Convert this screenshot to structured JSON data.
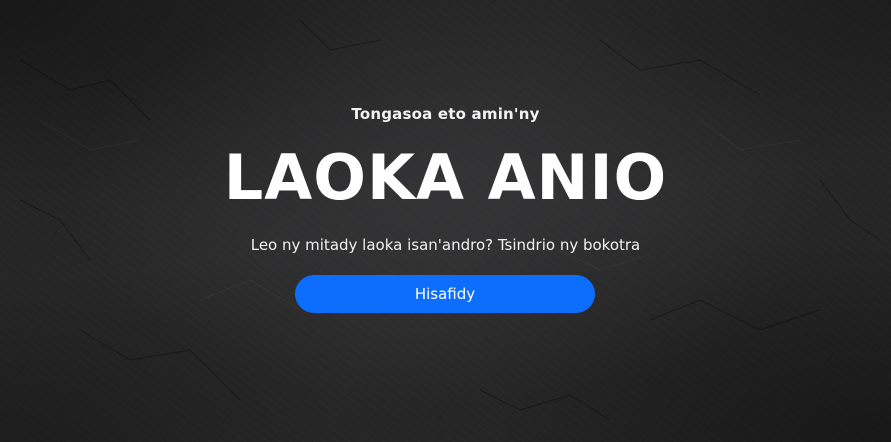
{
  "hero": {
    "greeting": "Tongasoa eto amin'ny",
    "title": "LAOKA ANIO",
    "subtitle": "Leo ny mitady laoka isan'andro? Tsindrio ny bokotra",
    "button_label": "Hisafidy"
  },
  "colors": {
    "background": "#2b2b2c",
    "button": "#0d6efd",
    "text": "#ffffff"
  }
}
